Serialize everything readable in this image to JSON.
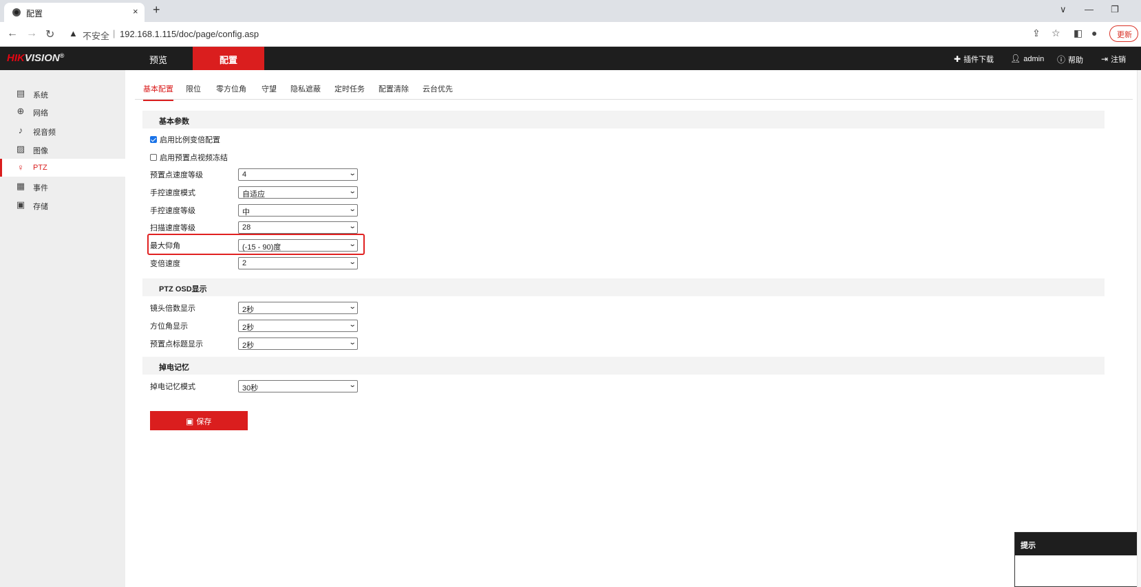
{
  "browser": {
    "tab_title": "配置",
    "tab_close": "×",
    "new_tab": "+",
    "security_label": "不安全",
    "separator": "|",
    "url": "192.168.1.115/doc/page/config.asp",
    "update_label": "更新",
    "controls": {
      "minimize": "—",
      "restore": "❐",
      "expand": "∨"
    }
  },
  "header": {
    "logo_a": "HIK",
    "logo_b": "VISION",
    "logo_mark": "®",
    "tabs": [
      {
        "label": "预览"
      },
      {
        "label": "配置"
      }
    ],
    "tools": {
      "plugin": "插件下载",
      "user": "admin",
      "help": "帮助",
      "logout": "注销"
    }
  },
  "sidebar": {
    "items": [
      {
        "label": "系统",
        "icon": "system-icon"
      },
      {
        "label": "网络",
        "icon": "network-icon"
      },
      {
        "label": "视音频",
        "icon": "video-audio-icon"
      },
      {
        "label": "图像",
        "icon": "image-icon"
      },
      {
        "label": "PTZ",
        "icon": "ptz-icon"
      },
      {
        "label": "事件",
        "icon": "event-icon"
      },
      {
        "label": "存储",
        "icon": "storage-icon"
      }
    ]
  },
  "subtabs": [
    "基本配置",
    "限位",
    "零方位角",
    "守望",
    "隐私遮蔽",
    "定时任务",
    "配置清除",
    "云台优先"
  ],
  "basic": {
    "title": "基本参数",
    "enable_zoom_ratio": "启用比例变倍配置",
    "enable_preset_freeze": "启用预置点视频冻结",
    "fields": [
      {
        "label": "预置点速度等级",
        "value": "4"
      },
      {
        "label": "手控速度模式",
        "value": "自适应"
      },
      {
        "label": "手控速度等级",
        "value": "中"
      },
      {
        "label": "扫描速度等级",
        "value": "28"
      },
      {
        "label": "最大仰角",
        "value": "(-15 - 90)度"
      },
      {
        "label": "变倍速度",
        "value": "2"
      }
    ]
  },
  "osd": {
    "title": "PTZ OSD显示",
    "fields": [
      {
        "label": "镜头倍数显示",
        "value": "2秒"
      },
      {
        "label": "方位角显示",
        "value": "2秒"
      },
      {
        "label": "预置点标题显示",
        "value": "2秒"
      }
    ]
  },
  "power": {
    "title": "掉电记忆",
    "fields": [
      {
        "label": "掉电记忆模式",
        "value": "30秒"
      }
    ]
  },
  "save_label": "保存",
  "hint_title": "提示",
  "colors": {
    "accent": "#da1e1e",
    "nav_bg": "#1e1e1e",
    "sidebar_bg": "#eeeeee"
  }
}
